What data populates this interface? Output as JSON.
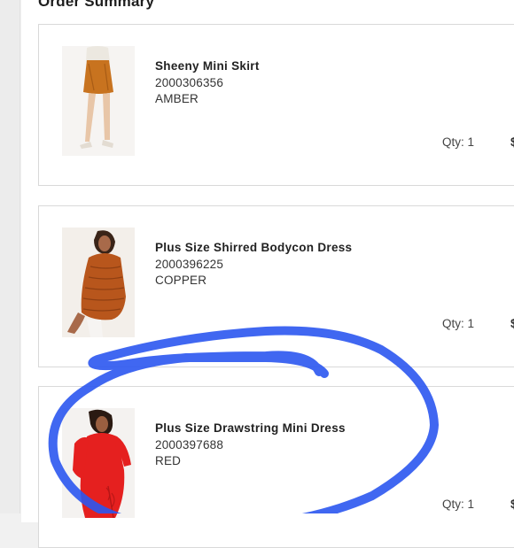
{
  "order_summary": {
    "title": "Order Summary",
    "items": [
      {
        "name": "Sheeny Mini Skirt",
        "sku": "2000306356",
        "color": "AMBER",
        "qty_label": "Qty:",
        "qty": "1",
        "price_prefix": "$"
      },
      {
        "name": "Plus Size Shirred Bodycon Dress",
        "sku": "2000396225",
        "color": "COPPER",
        "qty_label": "Qty:",
        "qty": "1",
        "price_prefix": "$"
      },
      {
        "name": "Plus Size Drawstring Mini Dress",
        "sku": "2000397688",
        "color": "RED",
        "qty_label": "Qty:",
        "qty": "1",
        "price_prefix": "$"
      }
    ]
  },
  "colors": {
    "annotation_circle": "#2b56f0",
    "amber": "#c8731f",
    "copper": "#b8561c",
    "red": "#e5201f"
  }
}
